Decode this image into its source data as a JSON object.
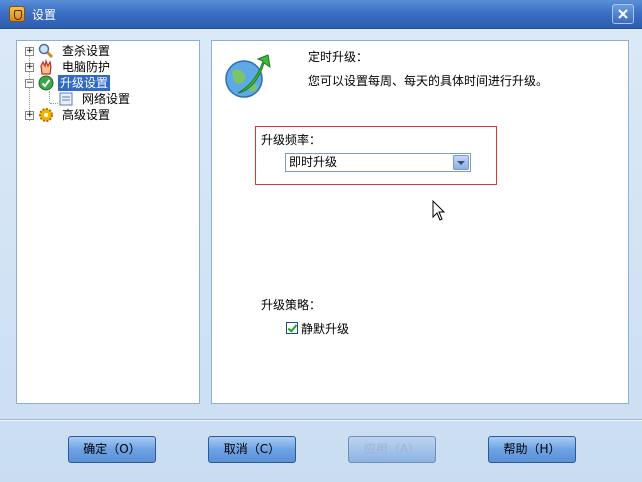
{
  "window": {
    "title": "设置",
    "close_label": ""
  },
  "tree": {
    "items": [
      {
        "label": "查杀设置",
        "icon": "magnifier-icon"
      },
      {
        "label": "电脑防护",
        "icon": "hand-shield-icon"
      },
      {
        "label": "升级设置",
        "icon": "green-check-icon",
        "selected": true
      },
      {
        "label": "网络设置",
        "icon": "network-icon"
      },
      {
        "label": "高级设置",
        "icon": "gear-icon"
      }
    ]
  },
  "content": {
    "title": "定时升级：",
    "description": "您可以设置每周、每天的具体时间进行升级。",
    "frequency_label": "升级频率：",
    "frequency_value": "即时升级",
    "policy_label": "升级策略：",
    "silent_update_label": "静默升级",
    "silent_update_checked": true
  },
  "buttons": {
    "ok": "确定（O）",
    "cancel": "取消（C）",
    "apply": "应用（A）",
    "help": "帮助（H）"
  },
  "colors": {
    "titlebar": "#3b6fc4",
    "selection": "#316ac5",
    "highlight_border": "#dd3333",
    "client_bg": "#d3e3f5"
  }
}
